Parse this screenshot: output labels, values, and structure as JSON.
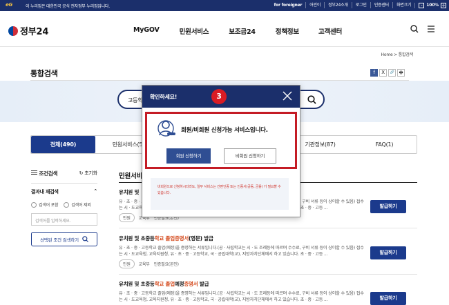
{
  "topbar": {
    "logo_mark": "eG",
    "message": "이 누리집은 대한민국 공식 전자정부 누리집입니다.",
    "links": [
      "for foreigner",
      "어린이",
      "정부24소개",
      "로그인",
      "인증센터",
      "화면크기"
    ],
    "zoom_minus": "-",
    "zoom_value": "100%",
    "zoom_plus": "+"
  },
  "header": {
    "logo_text": "정부24",
    "nav": [
      "MyGOV",
      "민원서비스",
      "보조금24",
      "정책정보",
      "고객센터"
    ]
  },
  "breadcrumb": {
    "home": "Home",
    "sep": ">",
    "current": "통합검색"
  },
  "page_title": "통합검색",
  "share": [
    "f",
    "X",
    "🔗",
    "🖶"
  ],
  "search": {
    "query": "고등학"
  },
  "tabs": [
    {
      "label": "전체(490)",
      "active": true
    },
    {
      "label": "민원서비스(5"
    },
    {
      "label": ""
    },
    {
      "label": ""
    },
    {
      "label": "기관정보(87)"
    },
    {
      "label": "FAQ(1)"
    }
  ],
  "filter": {
    "title": "조건검색",
    "reset": "초기화",
    "sub_title": "결과내 재검색",
    "radio_include": "검색어 포함",
    "radio_exclude": "검색어 제외",
    "input_placeholder": "검색어를 입력하세요.",
    "apply_label": "선택된 조건 검색하기"
  },
  "results_heading": "민원서비",
  "results": [
    {
      "title_pre": "유치원 및",
      "title_hl": "",
      "title_post": "",
      "desc": "유 · 초 · 중 · 고등학교 졸업(예정)을 증명하는 서류입니다.(공 · 사립학교는 시 · 도 조례등에 따르며 수수료, 구비 서류 등이 상이할 수 있음) 접수는 시 · 도교육청, 교육지원청, 유 · 초 · 중 · 고등학교, 국 · 공립대학(교), 지방자치단체에서 하고 있습니다. 초 · 중 · 고등 ...",
      "chip": "민원",
      "org": "교육부",
      "auth": "인증필요(본인)",
      "issue": "발급하기"
    },
    {
      "title_pre": "유치원 및 초중등",
      "title_hl": "학교 졸업증명서",
      "title_post": "(영문) 발급",
      "desc": "유 · 초 · 중 · 고등학교 졸업(예정)을 증명하는 서류입니다.(공 · 사립학교는 시 · 도 조례등에 따르며 수수료, 구비 서류 등이 상이할 수 있음) 접수는 시 · 도교육청, 교육지원청, 유 · 초 · 중 · 고등학교, 국 · 공립대학(교), 지방자치단체에서 하고 있습니다. 초 · 중 · 고등 ...",
      "chip": "민원",
      "org": "교육부",
      "auth": "인증필요(본인)",
      "issue": "발급하기"
    },
    {
      "title_pre": "유치원 및 초중등",
      "title_hl": "학교 졸업",
      "title_post": "예정",
      "title_hl2": "증명서",
      "title_post2": " 발급",
      "desc": "유 · 초 · 중 · 고등학교 졸업(예정)을 증명하는 서류입니다.(공 · 사립학교는 시 · 도 조례등에 따르며 수수료, 구비 서류 등이 상이할 수 있음) 접수는 시 · 도교육청, 교육지원청, 유 · 초 · 중 · 고등학교, 국 · 공립대학(교), 지방자치단체에서 하고 있습니다. 초 · 중 · 고등 ...",
      "issue": "발급하기"
    }
  ],
  "modal": {
    "title": "확인하세요!",
    "step_number": "3",
    "message": "회원/비회원 신청가능 서비스입니다.",
    "member_button": "회원 신청하기",
    "guest_button": "비회원 신청하기",
    "note": "비회원으로 신청하시더라도, 일부 서비스는 간편인증 또는 인증서(공동, 금융) 가 필요할 수 있습니다."
  },
  "colors": {
    "navy": "#1b2f6b",
    "accent": "#1b3a8c",
    "highlight": "#d44a1d",
    "marker": "#d91c24"
  }
}
